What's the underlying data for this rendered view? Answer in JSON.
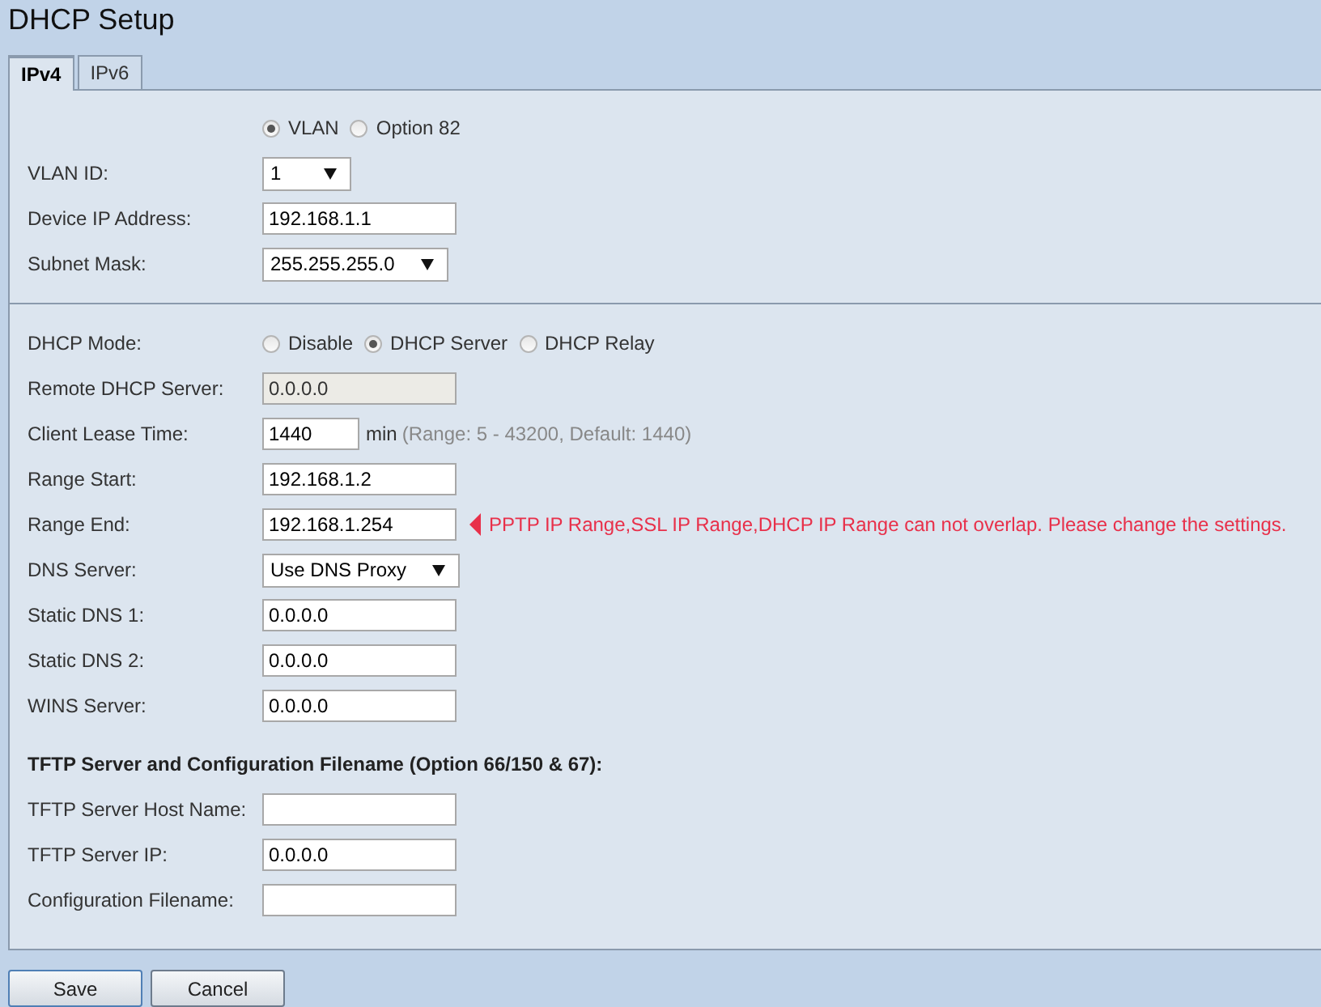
{
  "title": "DHCP Setup",
  "tabs": [
    {
      "label": "IPv4",
      "selected": true
    },
    {
      "label": "IPv6",
      "selected": false
    }
  ],
  "sections": [
    {
      "rows": [
        {
          "kind": "radio",
          "options": [
            {
              "label": "VLAN",
              "selected": true
            },
            {
              "label": "Option 82",
              "selected": false
            }
          ]
        },
        {
          "kind": "select",
          "label": "VLAN ID:",
          "value": "1"
        },
        {
          "kind": "text",
          "label": "Device IP Address:",
          "value": "192.168.1.1",
          "disabled": false
        },
        {
          "kind": "select",
          "label": "Subnet Mask:",
          "value": "255.255.255.0"
        }
      ]
    },
    {
      "rows": [
        {
          "kind": "radio",
          "label": "DHCP Mode:",
          "options": [
            {
              "label": "Disable",
              "selected": false
            },
            {
              "label": "DHCP Server",
              "selected": true
            },
            {
              "label": "DHCP Relay",
              "selected": false
            }
          ]
        },
        {
          "kind": "text",
          "label": "Remote DHCP Server:",
          "value": "0.0.0.0",
          "disabled": true
        },
        {
          "kind": "text",
          "label": "Client Lease Time:",
          "value": "1440",
          "disabled": false,
          "unit": "min",
          "hint": "(Range: 5 - 43200, Default: 1440)"
        },
        {
          "kind": "text",
          "label": "Range Start:",
          "value": "192.168.1.2",
          "disabled": false
        },
        {
          "kind": "text",
          "label": "Range End:",
          "value": "192.168.1.254",
          "disabled": false,
          "error": "PPTP IP Range,SSL IP Range,DHCP IP Range can not overlap. Please change the settings."
        },
        {
          "kind": "select",
          "label": "DNS Server:",
          "value": "Use DNS Proxy"
        },
        {
          "kind": "text",
          "label": "Static DNS 1:",
          "value": "0.0.0.0",
          "disabled": false
        },
        {
          "kind": "text",
          "label": "Static DNS 2:",
          "value": "0.0.0.0",
          "disabled": false
        },
        {
          "kind": "text",
          "label": "WINS Server:",
          "value": "0.0.0.0",
          "disabled": false
        },
        {
          "kind": "heading",
          "label": "TFTP Server and Configuration Filename (Option 66/150 & 67):"
        },
        {
          "kind": "text",
          "label": "TFTP Server Host Name:",
          "disabled": false
        },
        {
          "kind": "text",
          "label": "TFTP Server IP:",
          "value": "0.0.0.0",
          "disabled": false
        },
        {
          "kind": "text",
          "label": "Configuration Filename:",
          "disabled": false
        }
      ]
    }
  ],
  "buttons": [
    {
      "label": "Save",
      "kind": "primary"
    },
    {
      "label": "Cancel",
      "kind": "secondary"
    }
  ]
}
